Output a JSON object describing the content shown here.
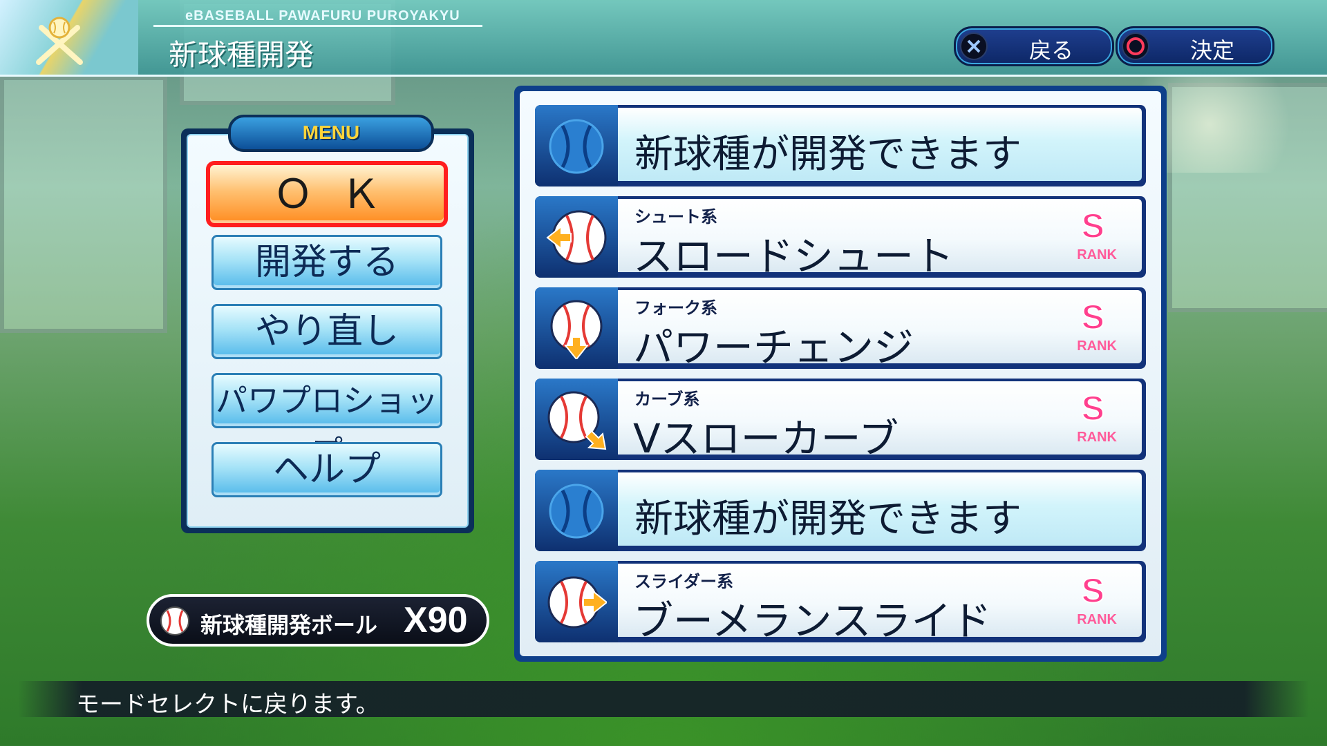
{
  "header": {
    "subtitle": "eBASEBALL PAWAFURU PUROYAKYU",
    "title": "新球種開発"
  },
  "top_buttons": {
    "back_label": "戻る",
    "confirm_label": "決定"
  },
  "menu": {
    "tab_label": "MENU",
    "ok_label": "ＯＫ",
    "develop_label": "開発する",
    "retry_label": "やり直し",
    "shop_label": "パワプロショップ",
    "help_label": "ヘルプ"
  },
  "ball_counter": {
    "label": "新球種開発ボール",
    "count": "X90"
  },
  "pitch_list": [
    {
      "empty": true,
      "text": "新球種が開発できます"
    },
    {
      "empty": false,
      "category": "シュート系",
      "name": "スロードシュート",
      "rank": "S",
      "rank_label": "RANK",
      "arrow": "left"
    },
    {
      "empty": false,
      "category": "フォーク系",
      "name": "パワーチェンジ",
      "rank": "S",
      "rank_label": "RANK",
      "arrow": "down"
    },
    {
      "empty": false,
      "category": "カーブ系",
      "name": "Vスローカーブ",
      "rank": "S",
      "rank_label": "RANK",
      "arrow": "down-right"
    },
    {
      "empty": true,
      "text": "新球種が開発できます"
    },
    {
      "empty": false,
      "category": "スライダー系",
      "name": "ブーメランスライド",
      "rank": "S",
      "rank_label": "RANK",
      "arrow": "right"
    }
  ],
  "status": {
    "message": "モードセレクトに戻ります。"
  },
  "colors": {
    "accent_orange": "#ff8c20",
    "selection_red": "#ff1e1e",
    "rank_pink": "#ff3f8e",
    "panel_navy": "#0e3f8a"
  }
}
